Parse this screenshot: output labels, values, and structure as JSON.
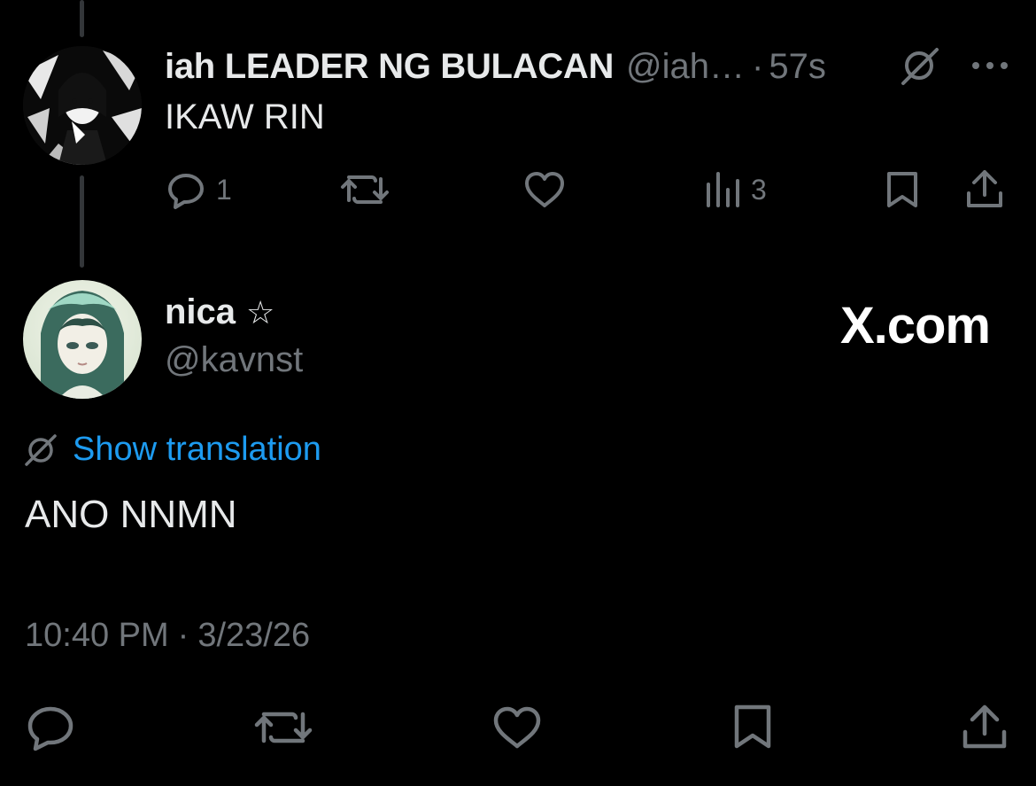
{
  "parent_tweet": {
    "display_name": "iah LEADER NG BULACAN",
    "handle": "@iah…",
    "separator": "·",
    "time_ago": "57s",
    "text": "IKAW RIN",
    "reply_count": "1",
    "views_count": "3"
  },
  "main_tweet": {
    "display_name": "nica",
    "name_emoji": "☆",
    "handle": "@kavnst",
    "watermark": "X.com",
    "show_translation": "Show translation",
    "text": "ANO NNMN",
    "time": "10:40 PM",
    "separator": "·",
    "date": "3/23/26"
  },
  "colors": {
    "background": "#000000",
    "primary_text": "#e7e9ea",
    "secondary_text": "#71767b",
    "link": "#1d9bf0"
  },
  "icons": {
    "parent_actions": [
      "reply-icon",
      "retweet-icon",
      "like-icon",
      "views-icon",
      "bookmark-icon",
      "share-icon"
    ],
    "main_actions": [
      "reply-icon",
      "retweet-icon",
      "like-icon",
      "bookmark-icon",
      "share-icon"
    ],
    "other": [
      "grok-icon",
      "more-icon",
      "translate-icon"
    ]
  }
}
